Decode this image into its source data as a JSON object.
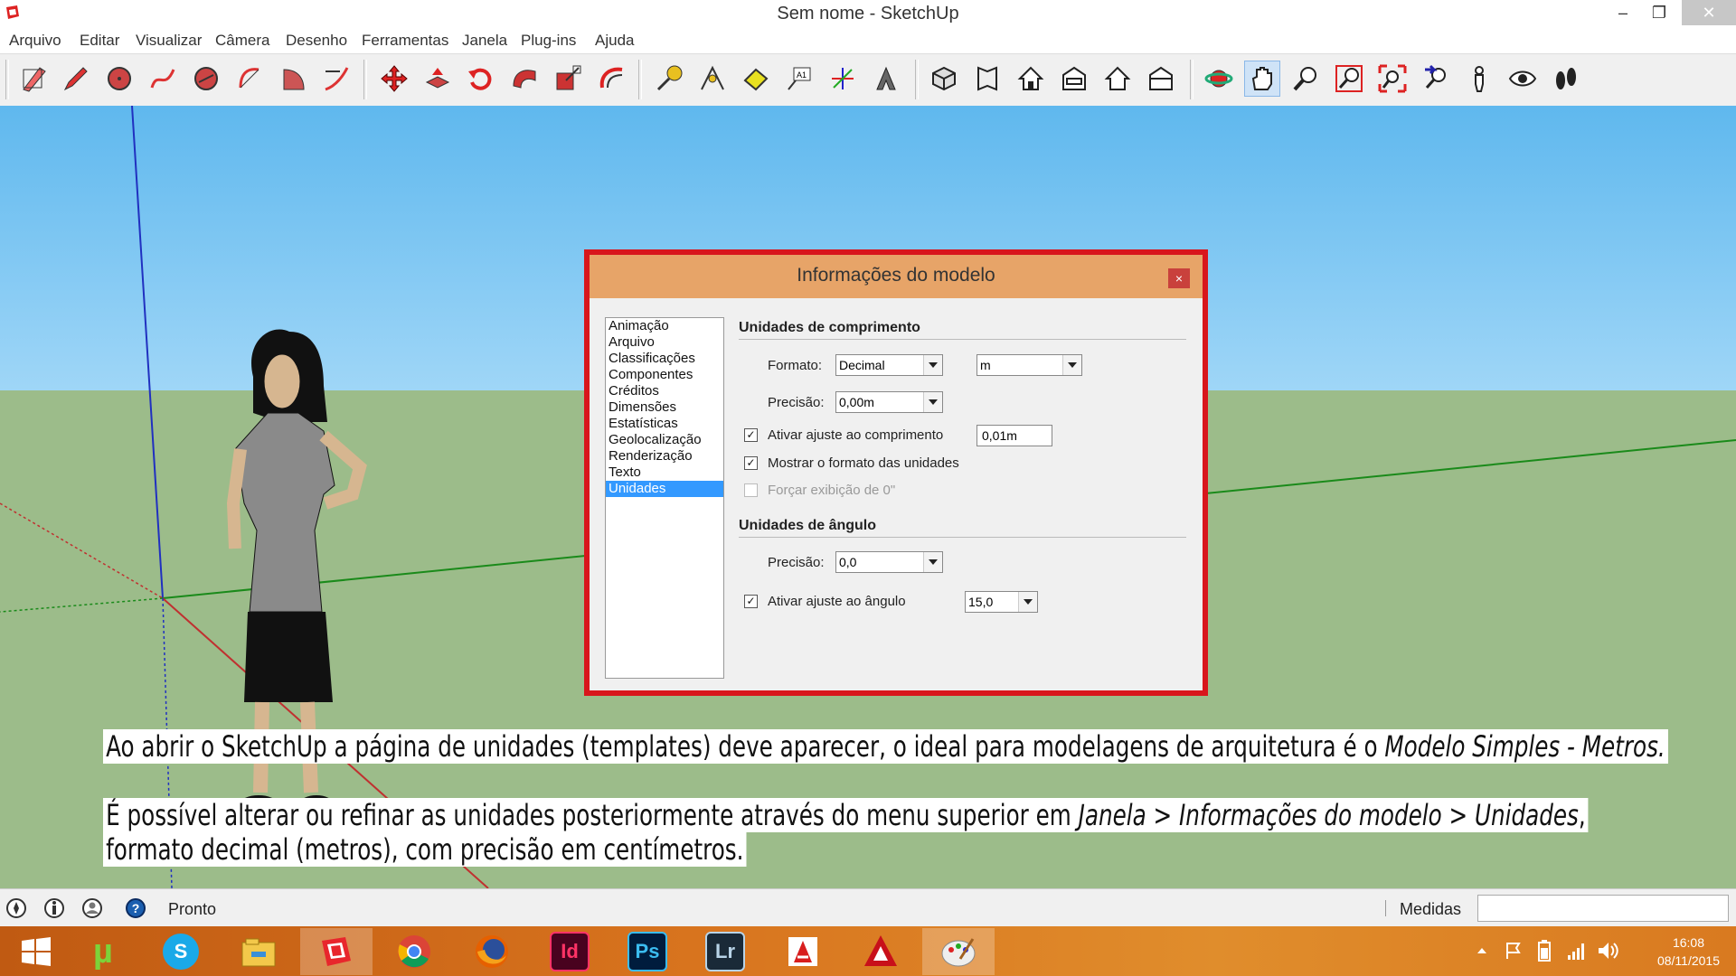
{
  "window": {
    "title": "Sem nome - SketchUp",
    "minimize": "–",
    "maximize": "❐",
    "close": "✕"
  },
  "menu": [
    "Arquivo",
    "Editar",
    "Visualizar",
    "Câmera",
    "Desenho",
    "Ferramentas",
    "Janela",
    "Plug-ins",
    "Ajuda"
  ],
  "toolbar": {
    "groups": [
      [
        "eraser-icon",
        "pencil-icon",
        "circle-icon",
        "freehand-icon",
        "arc-icon",
        "arc-3pt-icon",
        "pie-icon",
        "arc-2pt-icon"
      ],
      [
        "move-icon",
        "push-pull-icon",
        "rotate-icon",
        "follow-me-icon",
        "scale-icon",
        "offset-icon"
      ],
      [
        "tape-measure-icon",
        "protractor-icon",
        "paint-bucket-icon",
        "text-icon",
        "axes-icon",
        "3d-text-icon"
      ],
      [
        "iso-view-icon",
        "top-view-icon",
        "front-view-icon",
        "right-view-icon",
        "back-view-icon",
        "left-view-icon"
      ],
      [
        "orbit-icon",
        "pan-icon",
        "zoom-icon",
        "zoom-window-icon",
        "zoom-extents-icon",
        "previous-view-icon",
        "position-camera-icon",
        "look-around-icon",
        "walk-icon"
      ]
    ],
    "active": "pan-icon"
  },
  "dialog": {
    "title": "Informações do modelo",
    "close": "×",
    "categories": [
      "Animação",
      "Arquivo",
      "Classificações",
      "Componentes",
      "Créditos",
      "Dimensões",
      "Estatísticas",
      "Geolocalização",
      "Renderização",
      "Texto",
      "Unidades"
    ],
    "selected_category": "Unidades",
    "length": {
      "heading": "Unidades de comprimento",
      "format_label": "Formato:",
      "format_value": "Decimal",
      "unit_value": "m",
      "precision_label": "Precisão:",
      "precision_value": "0,00m",
      "snap_label": "Ativar ajuste ao comprimento",
      "snap_checked": true,
      "snap_value": "0,01m",
      "show_format_label": "Mostrar o formato das unidades",
      "show_format_checked": true,
      "force_zero_label": "Forçar exibição de 0\"",
      "force_zero_checked": false
    },
    "angle": {
      "heading": "Unidades de ângulo",
      "precision_label": "Precisão:",
      "precision_value": "0,0",
      "snap_label": "Ativar ajuste ao ângulo",
      "snap_checked": true,
      "snap_value": "15,0"
    }
  },
  "captions": {
    "line1_a": "Ao abrir o SketchUp a página de unidades (templates) deve aparecer, o ideal para modelagens de arquitetura é o ",
    "line1_b": "Modelo Simples - Metros.",
    "line2_a": "É possível alterar ou refinar as unidades posteriormente através do menu superior em ",
    "line2_b": "Janela > Informações do modelo > Unidades",
    "line2_c": ",",
    "line3": "formato decimal (metros), com precisão em centímetros."
  },
  "status": {
    "text": "Pronto",
    "measure_label": "Medidas",
    "measure_value": ""
  },
  "taskbar": {
    "apps": [
      {
        "name": "start-icon",
        "label": ""
      },
      {
        "name": "utorrent-icon",
        "label": "µ"
      },
      {
        "name": "skype-icon",
        "label": "S"
      },
      {
        "name": "file-explorer-icon",
        "label": ""
      },
      {
        "name": "sketchup-icon",
        "label": ""
      },
      {
        "name": "chrome-icon",
        "label": ""
      },
      {
        "name": "firefox-icon",
        "label": ""
      },
      {
        "name": "indesign-icon",
        "label": "Id"
      },
      {
        "name": "photoshop-icon",
        "label": "Ps"
      },
      {
        "name": "lightroom-icon",
        "label": "Lr"
      },
      {
        "name": "acrobat-icon",
        "label": ""
      },
      {
        "name": "autocad-icon",
        "label": ""
      },
      {
        "name": "paint-icon",
        "label": ""
      }
    ],
    "time": "16:08",
    "date": "08/11/2015"
  },
  "colors": {
    "dialog_border": "#d8161c",
    "dialog_title": "#e7a468",
    "taskbar": "#d8741e",
    "selection": "#3399ff"
  }
}
